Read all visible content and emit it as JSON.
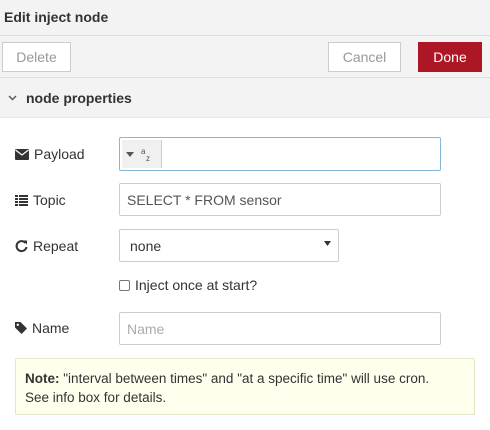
{
  "window": {
    "title": "Edit inject node"
  },
  "toolbar": {
    "delete_label": "Delete",
    "cancel_label": "Cancel",
    "done_label": "Done"
  },
  "section": {
    "title": "node properties"
  },
  "form": {
    "payload": {
      "label": "Payload",
      "type_icon": "string-az-icon",
      "value": ""
    },
    "topic": {
      "label": "Topic",
      "value": "SELECT * FROM sensor"
    },
    "repeat": {
      "label": "Repeat",
      "selected": "none"
    },
    "inject_once": {
      "label": "Inject once at start?",
      "checked": false
    },
    "name": {
      "label": "Name",
      "value": "",
      "placeholder": "Name"
    }
  },
  "note": {
    "prefix": "Note:",
    "text": "\"interval between times\" and \"at a specific time\" will use cron.",
    "text2": "See info box for details."
  },
  "colors": {
    "done_button": "#ad1625",
    "panel_bg": "#f3f3f3",
    "note_bg": "#ffffee",
    "focus_border": "#85b7d9"
  }
}
